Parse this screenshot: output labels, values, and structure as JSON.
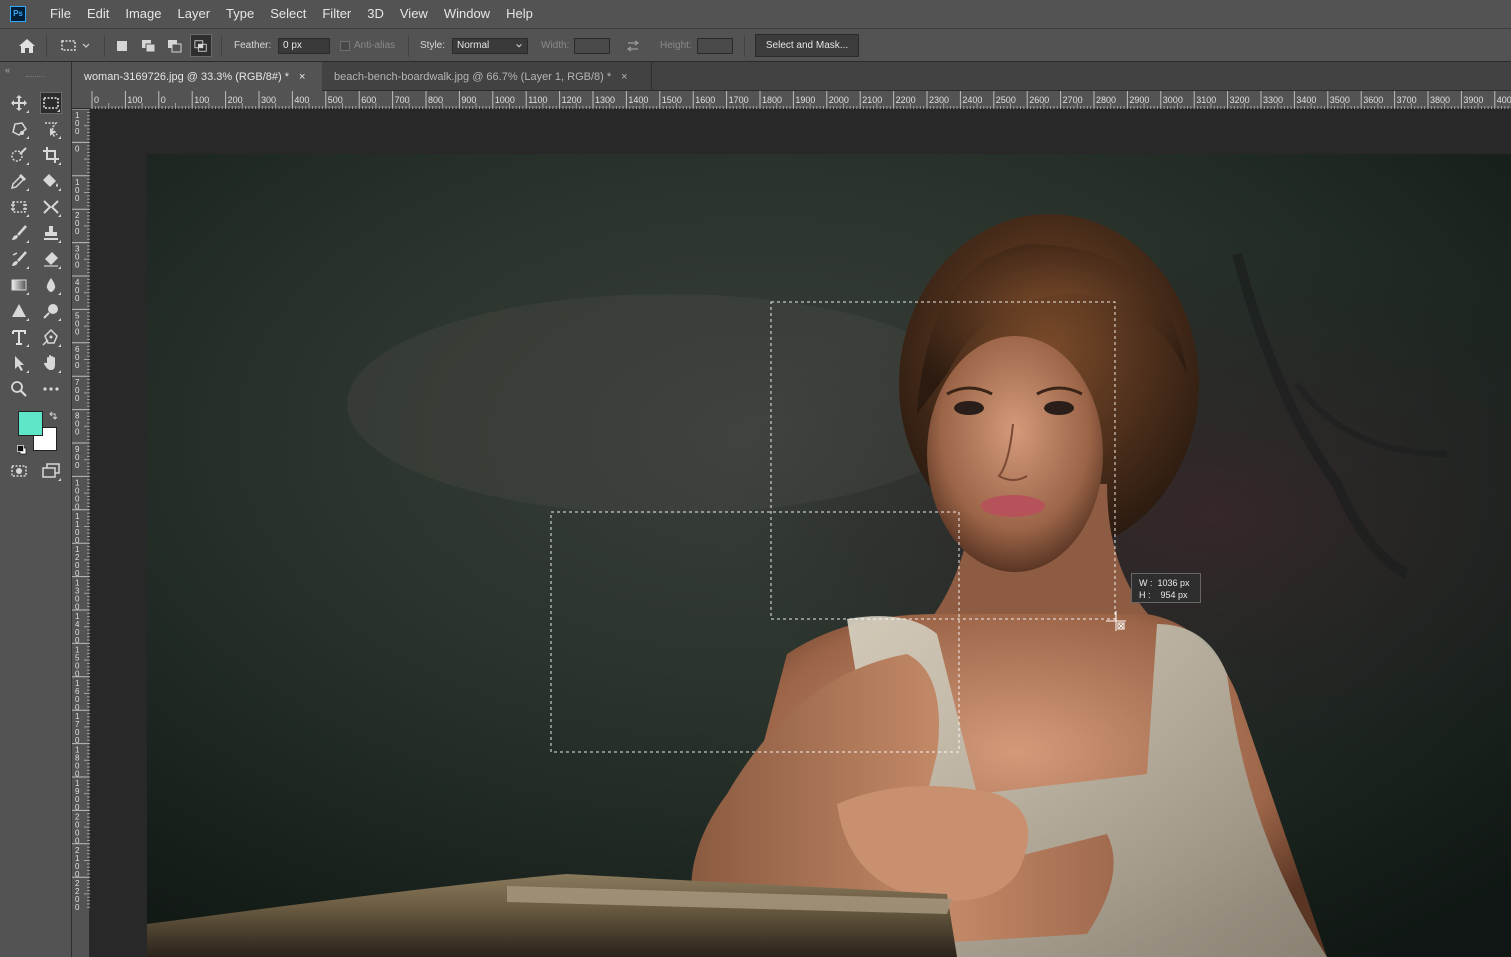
{
  "app": {
    "logo_text": "Ps"
  },
  "menu": [
    "File",
    "Edit",
    "Image",
    "Layer",
    "Type",
    "Select",
    "Filter",
    "3D",
    "View",
    "Window",
    "Help"
  ],
  "options": {
    "feather_label": "Feather:",
    "feather_value": "0 px",
    "anti_alias_label": "Anti-alias",
    "style_label": "Style:",
    "style_value": "Normal",
    "width_label": "Width:",
    "height_label": "Height:",
    "select_and_mask": "Select and Mask..."
  },
  "tabs": [
    {
      "title": "woman-3169726.jpg @ 33.3% (RGB/8#) *",
      "close": "×"
    },
    {
      "title": "beach-bench-boardwalk.jpg @ 66.7% (Layer 1, RGB/8) *",
      "close": "×"
    }
  ],
  "ruler": {
    "top_ticks": [
      "0",
      "100",
      "0",
      "100",
      "200",
      "300",
      "400",
      "500",
      "600",
      "700",
      "800",
      "900",
      "1000",
      "1100",
      "1200",
      "1300",
      "1400",
      "1500",
      "1600",
      "1700",
      "1800",
      "1900",
      "2000",
      "2100",
      "2200",
      "2300",
      "2400",
      "2500",
      "2600",
      "2700",
      "2800",
      "2900",
      "3000",
      "3100",
      "3200",
      "3300",
      "3400",
      "3500",
      "3600",
      "3700",
      "3800",
      "3900",
      "4000"
    ],
    "left_ticks": [
      "1\n0\n0",
      "0",
      "1\n0\n0",
      "2\n0\n0",
      "3\n0\n0",
      "4\n0\n0",
      "5\n0\n0",
      "6\n0\n0",
      "7\n0\n0",
      "8\n0\n0",
      "9\n0\n0",
      "1\n0\n0\n0",
      "1\n1\n0\n0",
      "1\n2\n0\n0",
      "1\n3\n0\n0",
      "1\n4\n0\n0",
      "1\n5\n0\n0",
      "1\n6\n0\n0",
      "1\n7\n0\n0",
      "1\n8\n0\n0",
      "1\n9\n0\n0",
      "2\n0\n0\n0",
      "2\n1\n0\n0",
      "2\n2\n0\n0"
    ]
  },
  "hud": {
    "w": "W :  1036 px",
    "h": "H :    954 px"
  },
  "colors": {
    "foreground": "#5fe6c8",
    "background": "#ffffff"
  },
  "tools": [
    "move-icon",
    "marquee-rect-icon",
    "lasso-icon",
    "object-select-icon",
    "quick-select-icon",
    "crop-icon",
    "eyedropper-icon",
    "paint-bucket-icon",
    "frame-icon",
    "transform-icon",
    "brush-icon",
    "stamp-icon",
    "mixer-brush-icon",
    "eraser-icon",
    "gradient-icon",
    "blur-drop-icon",
    "shape-triangle-icon",
    "dodge-icon",
    "type-icon",
    "pen-icon",
    "path-select-icon",
    "hand-icon",
    "zoom-icon",
    "more-icon"
  ]
}
